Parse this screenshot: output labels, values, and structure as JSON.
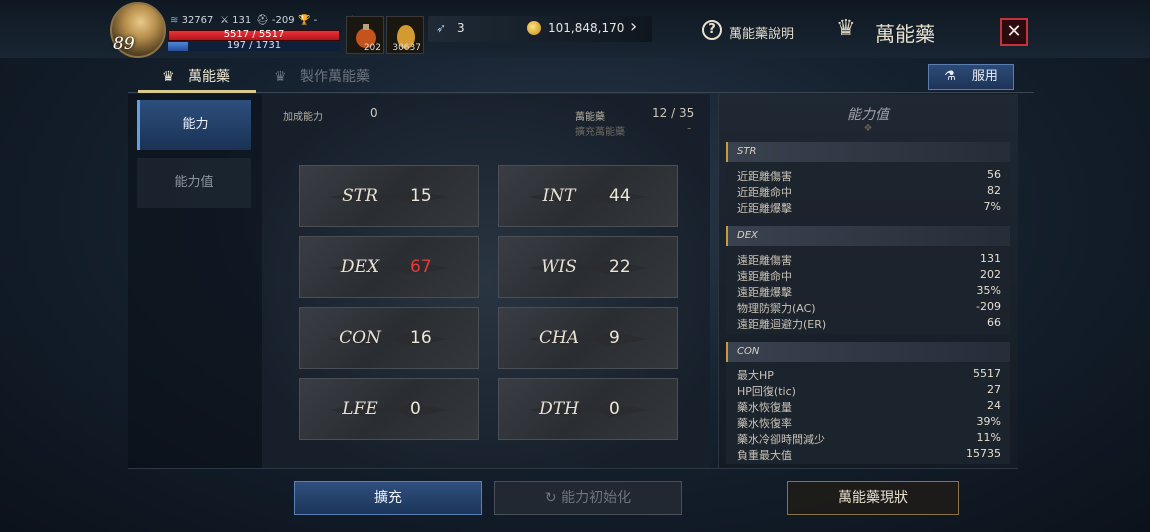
{
  "player": {
    "level": "89",
    "stat_a": "32767",
    "stat_b": "131",
    "stat_c": "-209",
    "stat_d": "-",
    "hp": "5517 / 5517",
    "mp": "197 / 1731",
    "mp_fraction": 0.114
  },
  "items": {
    "potion_count": "202",
    "egg_count": "30637"
  },
  "currency": {
    "feather": "3",
    "gold": "101,848,170"
  },
  "header": {
    "help_label": "萬能藥說明",
    "title": "萬能藥",
    "close": "✕"
  },
  "tabs": [
    {
      "label": "萬能藥"
    },
    {
      "label": "製作萬能藥"
    }
  ],
  "use_button": "服用",
  "nav": [
    {
      "label": "能力"
    },
    {
      "label": "能力值"
    }
  ],
  "center": {
    "bonus_label": "加成能力",
    "bonus_value": "0",
    "elixir_label": "萬能藥",
    "elixir_value": "12 / 35",
    "expand_label": "擴充萬能藥",
    "expand_value": "-"
  },
  "stats": [
    {
      "name": "STR",
      "value": "15"
    },
    {
      "name": "INT",
      "value": "44"
    },
    {
      "name": "DEX",
      "value": "67"
    },
    {
      "name": "WIS",
      "value": "22"
    },
    {
      "name": "CON",
      "value": "16"
    },
    {
      "name": "CHA",
      "value": "9"
    },
    {
      "name": "LFE",
      "value": "0"
    },
    {
      "name": "DTH",
      "value": "0"
    }
  ],
  "right": {
    "title": "能力值",
    "groups": [
      {
        "name": "STR",
        "rows": [
          {
            "k": "近距離傷害",
            "v": "56"
          },
          {
            "k": "近距離命中",
            "v": "82"
          },
          {
            "k": "近距離爆擊",
            "v": "7%"
          }
        ]
      },
      {
        "name": "DEX",
        "rows": [
          {
            "k": "遠距離傷害",
            "v": "131"
          },
          {
            "k": "遠距離命中",
            "v": "202"
          },
          {
            "k": "遠距離爆擊",
            "v": "35%"
          },
          {
            "k": "物理防禦力(AC)",
            "v": "-209"
          },
          {
            "k": "遠距離迴避力(ER)",
            "v": "66"
          }
        ]
      },
      {
        "name": "CON",
        "rows": [
          {
            "k": "最大HP",
            "v": "5517"
          },
          {
            "k": "HP回復(tic)",
            "v": "27"
          },
          {
            "k": "藥水恢復量",
            "v": "24"
          },
          {
            "k": "藥水恢復率",
            "v": "39%"
          },
          {
            "k": "藥水冷卻時間減少",
            "v": "11%"
          },
          {
            "k": "負重最大值",
            "v": "15735"
          }
        ]
      }
    ]
  },
  "bottom": {
    "expand": "擴充",
    "reset": "能力初始化",
    "status": "萬能藥現狀"
  },
  "colors": {
    "accent_blue": "#2d4f7c",
    "hp_red": "#e9333a",
    "highlight_red": "#e43a3a",
    "gold": "#c89a3e"
  }
}
